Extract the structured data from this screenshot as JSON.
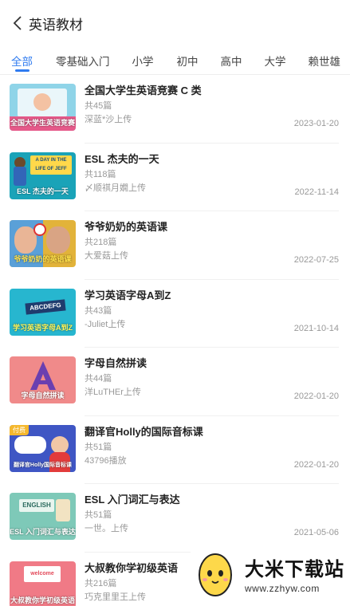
{
  "header": {
    "title": "英语教材",
    "back_icon": "chevron-left-icon"
  },
  "tabs": [
    {
      "label": "全部",
      "active": true
    },
    {
      "label": "零基础入门",
      "active": false
    },
    {
      "label": "小学",
      "active": false
    },
    {
      "label": "初中",
      "active": false
    },
    {
      "label": "高中",
      "active": false
    },
    {
      "label": "大学",
      "active": false
    },
    {
      "label": "赖世雄",
      "active": false
    }
  ],
  "items": [
    {
      "title": "全国大学生英语竞赛 C 类",
      "count": "共45篇",
      "uploader": "深蓝*沙上传",
      "date": "2023-01-20",
      "caption": "全国大学生英语竞赛",
      "color": "#8fd4e8"
    },
    {
      "title": "ESL 杰夫的一天",
      "count": "共118篇",
      "uploader": "〆顺祺月嫺上传",
      "date": "2022-11-14",
      "caption": "ESL 杰夫的一天",
      "banner": "A DAY IN THE LIFE OF JEFF",
      "color": "#1aa3b8"
    },
    {
      "title": "爷爷奶奶的英语课",
      "count": "共218篇",
      "uploader": "大爱菇上传",
      "date": "2022-07-25",
      "caption": "爷爷奶奶的英语课",
      "color": "#e2b33a"
    },
    {
      "title": "学习英语字母A到Z",
      "count": "共43篇",
      "uploader": "-Juliet上传",
      "date": "2021-10-14",
      "caption": "学习英语字母A到Z",
      "banner": "ABCDEFG",
      "color": "#27b6cf"
    },
    {
      "title": "字母自然拼读",
      "count": "共44篇",
      "uploader": "洋LuTHEr上传",
      "date": "2022-01-20",
      "caption": "字母自然拼读",
      "color": "#f08a8a"
    },
    {
      "title": "翻译官Holly的国际音标课",
      "count": "共51篇",
      "uploader": "43796播放",
      "date": "2022-01-20",
      "caption": "翻译官Holly国际音标课",
      "badge": "付费",
      "color": "#3f56c4"
    },
    {
      "title": "ESL 入门词汇与表达",
      "count": "共51篇",
      "uploader": "一世。上传",
      "date": "2021-05-06",
      "caption": "ESL 入门词汇与表达",
      "banner": "ENGLISH",
      "color": "#7ec9b8"
    },
    {
      "title": "大叔教你学初级英语",
      "count": "共216篇",
      "uploader": "巧克里里王上传",
      "date": "",
      "caption": "大叔教你学初级英语",
      "banner": "welcome",
      "color": "#f07a86"
    }
  ],
  "watermark": {
    "name": "大米下载站",
    "url": "www.zzhyw.com",
    "icon": "egg-mascot-icon"
  }
}
